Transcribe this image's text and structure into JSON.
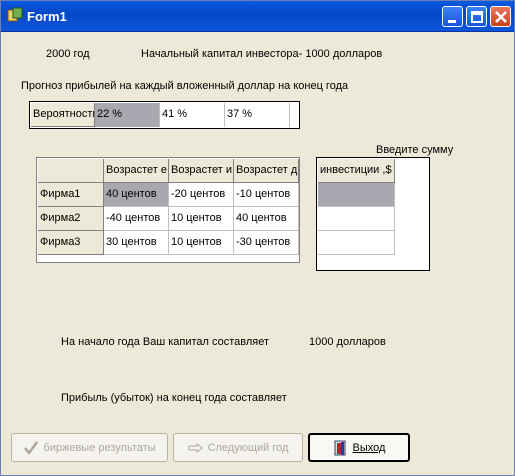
{
  "window": {
    "title": "Form1"
  },
  "header": {
    "year": "2000 год",
    "capital": "Начальный капитал инвестора- 1000 долларов",
    "forecast": "Прогноз прибылей на каждый вложенный доллар на конец года"
  },
  "probability": {
    "label": "Вероятности",
    "values": [
      "22 %",
      "41 %",
      "37 %"
    ]
  },
  "invest": {
    "prompt": "Введите сумму",
    "header": "инвестиции ,$",
    "values": [
      "",
      "",
      ""
    ]
  },
  "grid": {
    "headers": [
      "Возрастет е",
      "Возрастет и",
      "Возрастет д"
    ],
    "rows": [
      {
        "name": "Фирма1",
        "cells": [
          "40 центов",
          "-20 центов",
          "-10 центов"
        ]
      },
      {
        "name": "Фирма2",
        "cells": [
          "-40 центов",
          "10 центов",
          "40 центов"
        ]
      },
      {
        "name": "Фирма3",
        "cells": [
          "30 центов",
          "10 центов",
          "-30 центов"
        ]
      }
    ]
  },
  "status": {
    "start_capital_label": "На начало года Ваш капитал составляет",
    "start_capital_value": "1000 долларов",
    "profit_label": "Прибыль (убыток) на конец года составляет"
  },
  "buttons": {
    "results": "биржевые результаты",
    "next_year": "Следующий год",
    "exit": "Выход"
  },
  "icons": {
    "app": "app-icon",
    "results": "checkmark-icon",
    "next": "pointing-hand-icon",
    "exit": "exit-door-icon"
  }
}
